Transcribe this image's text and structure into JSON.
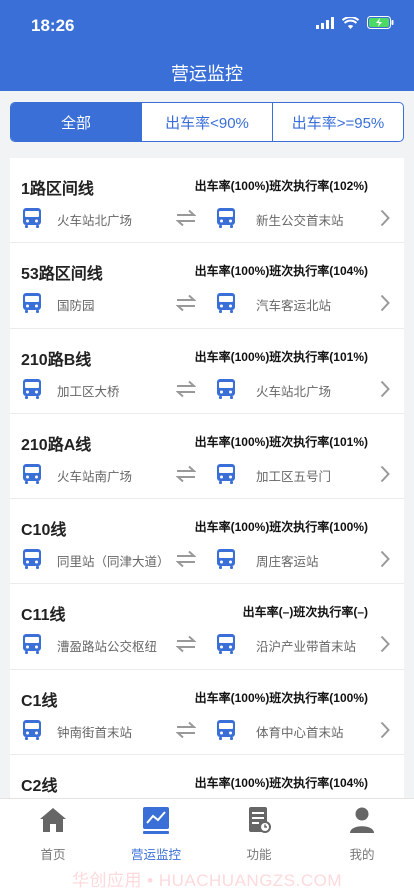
{
  "status_bar": {
    "time": "18:26"
  },
  "nav": {
    "title": "营运监控"
  },
  "filters": [
    "全部",
    "出车率<90%",
    "出车率>=95%"
  ],
  "routes": [
    {
      "name": "1路区间线",
      "rates": "出车率(100%)班次执行率(102%)",
      "from": "火车站北广场",
      "to": "新生公交首末站"
    },
    {
      "name": "53路区间线",
      "rates": "出车率(100%)班次执行率(104%)",
      "from": "国防园",
      "to": "汽车客运北站"
    },
    {
      "name": "210路B线",
      "rates": "出车率(100%)班次执行率(101%)",
      "from": "加工区大桥",
      "to": "火车站北广场"
    },
    {
      "name": "210路A线",
      "rates": "出车率(100%)班次执行率(101%)",
      "from": "火车站南广场",
      "to": "加工区五号门"
    },
    {
      "name": "C10线",
      "rates": "出车率(100%)班次执行率(100%)",
      "from": "同里站（同津大道）",
      "to": "周庄客运站"
    },
    {
      "name": "C11线",
      "rates": "出车率(–)班次执行率(–)",
      "from": "漕盈路站公交枢纽",
      "to": "沿沪产业带首末站"
    },
    {
      "name": "C1线",
      "rates": "出车率(100%)班次执行率(100%)",
      "from": "钟南街首末站",
      "to": "体育中心首末站"
    },
    {
      "name": "C2线",
      "rates": "出车率(100%)班次执行率(104%)",
      "from": "",
      "to": ""
    }
  ],
  "tabs": [
    {
      "label": "首页",
      "icon": "home-icon"
    },
    {
      "label": "营运监控",
      "icon": "monitor-chart-icon"
    },
    {
      "label": "功能",
      "icon": "document-icon"
    },
    {
      "label": "我的",
      "icon": "user-icon"
    }
  ],
  "watermark": "华创应用 • HUACHUANGZS.COM",
  "colors": {
    "primary": "#3a6fd8",
    "background": "#f2f3f5"
  }
}
